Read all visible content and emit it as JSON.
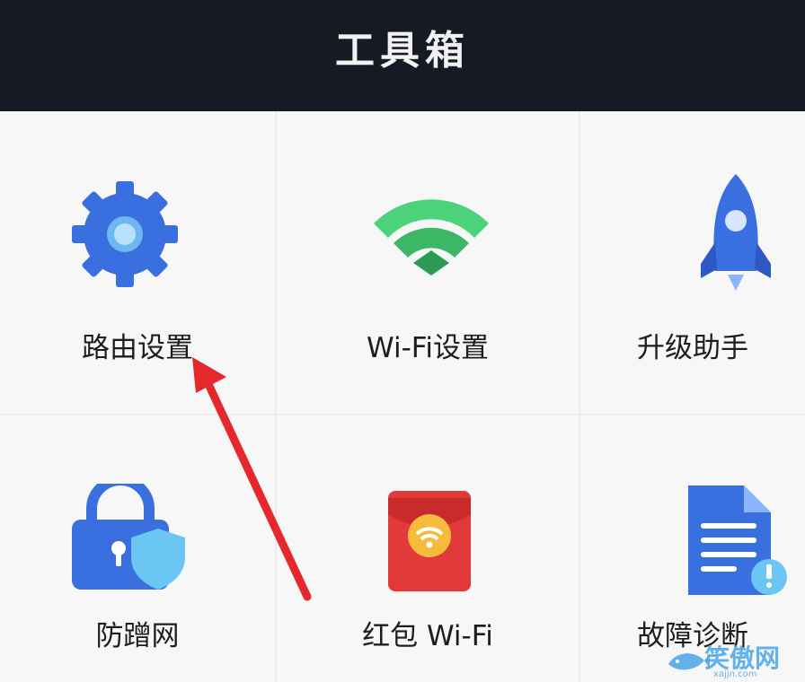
{
  "header": {
    "title": "工具箱"
  },
  "tools": [
    {
      "label": "路由设置",
      "icon": "gear-icon"
    },
    {
      "label": "Wi-Fi设置",
      "icon": "wifi-icon"
    },
    {
      "label": "升级助手",
      "icon": "rocket-icon"
    },
    {
      "label": "防蹭网",
      "icon": "lock-shield-icon"
    },
    {
      "label": "红包 Wi-Fi",
      "icon": "red-envelope-wifi-icon"
    },
    {
      "label": "故障诊断",
      "icon": "document-alert-icon"
    }
  ],
  "watermark": {
    "text": "笑傲网",
    "sub": "xajjn.com"
  },
  "colors": {
    "header_bg": "#161a25",
    "blue": "#3a6fe0",
    "green": "#3fbf6a",
    "red": "#e23a3a",
    "arrow": "#e4282c"
  }
}
